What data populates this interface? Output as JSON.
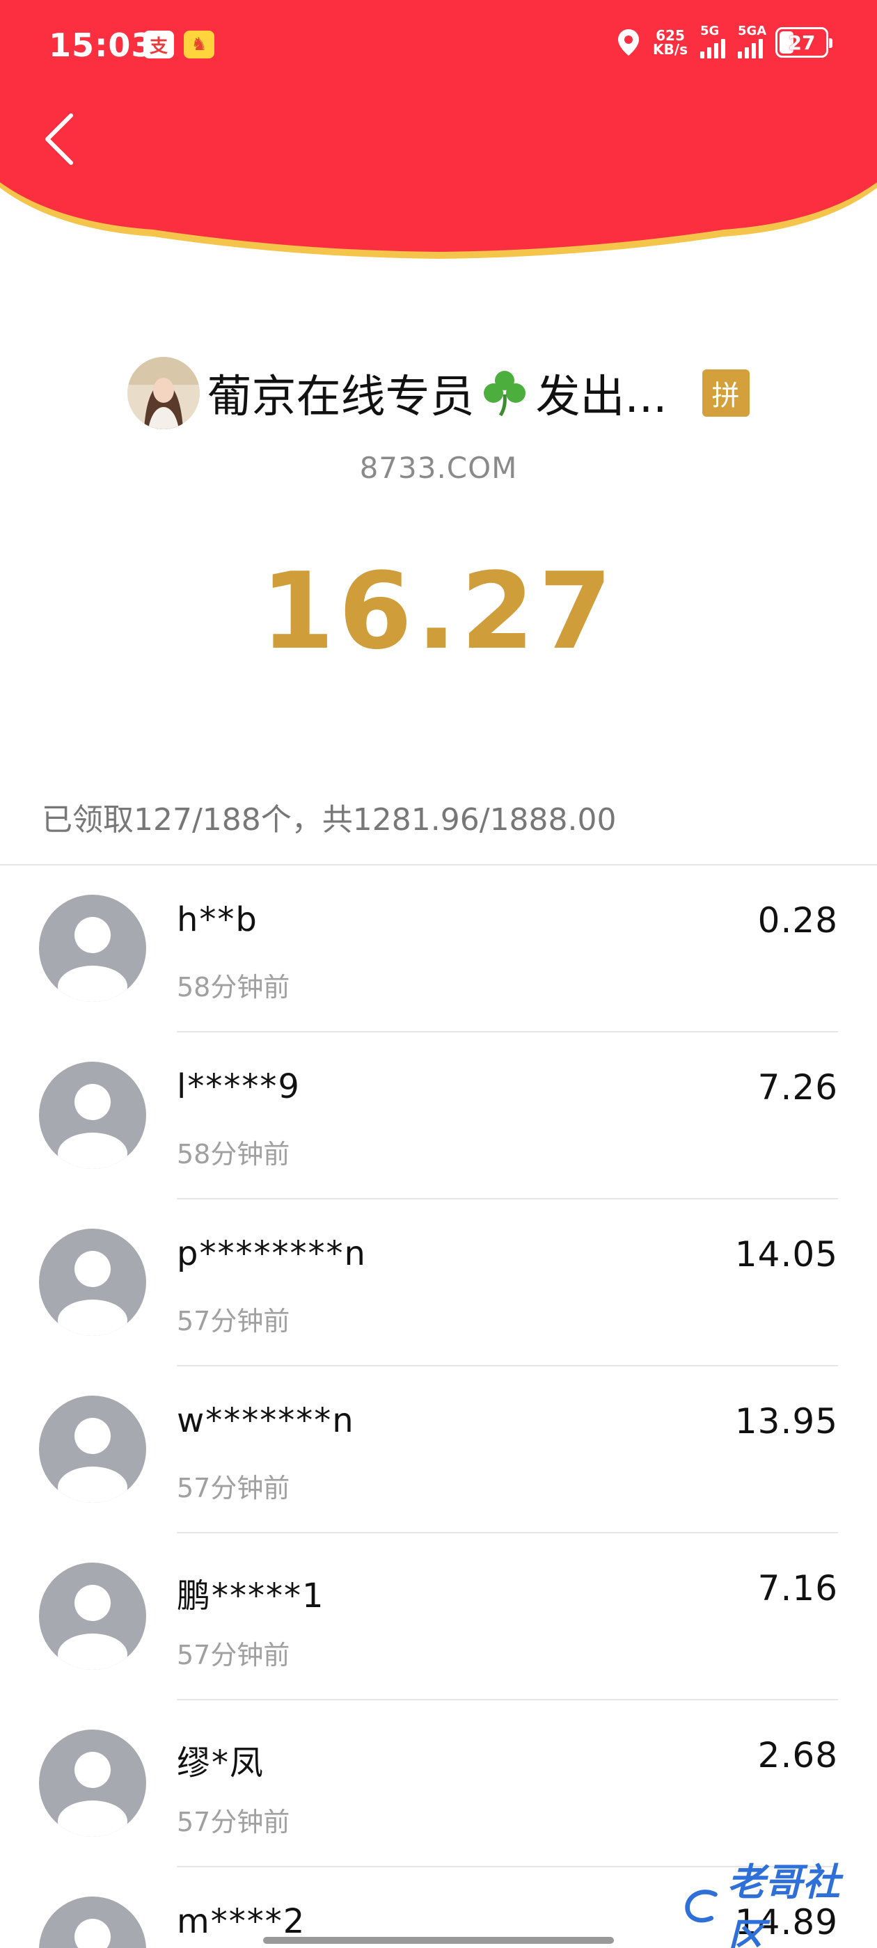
{
  "status_bar": {
    "time": "15:03",
    "app_icons": [
      "支",
      "♞"
    ],
    "net_speed_value": "625",
    "net_speed_unit": "KB/s",
    "sim1_label": "5G",
    "sim2_label": "5GA",
    "battery": "27"
  },
  "colors": {
    "header_red": "#fb2f3f",
    "header_border": "#f5c44a",
    "amount_gold": "#cf9d3a",
    "badge_gold": "#d4a03c"
  },
  "sender": {
    "name": "葡京在线专员",
    "suffix": "发出...",
    "badge": "拼",
    "subtitle": "8733.COM"
  },
  "amount": "16.27",
  "summary": "已领取127/188个，共1281.96/1888.00",
  "recipients": [
    {
      "name": "h**b",
      "time": "58分钟前",
      "value": "0.28"
    },
    {
      "name": "l*****9",
      "time": "58分钟前",
      "value": "7.26"
    },
    {
      "name": "p********n",
      "time": "57分钟前",
      "value": "14.05"
    },
    {
      "name": "w*******n",
      "time": "57分钟前",
      "value": "13.95"
    },
    {
      "name": "鹏*****1",
      "time": "57分钟前",
      "value": "7.16"
    },
    {
      "name": "缪*凤",
      "time": "57分钟前",
      "value": "2.68"
    },
    {
      "name": "m****2",
      "time": "",
      "value": "14.89"
    }
  ],
  "watermark": "老哥社区"
}
